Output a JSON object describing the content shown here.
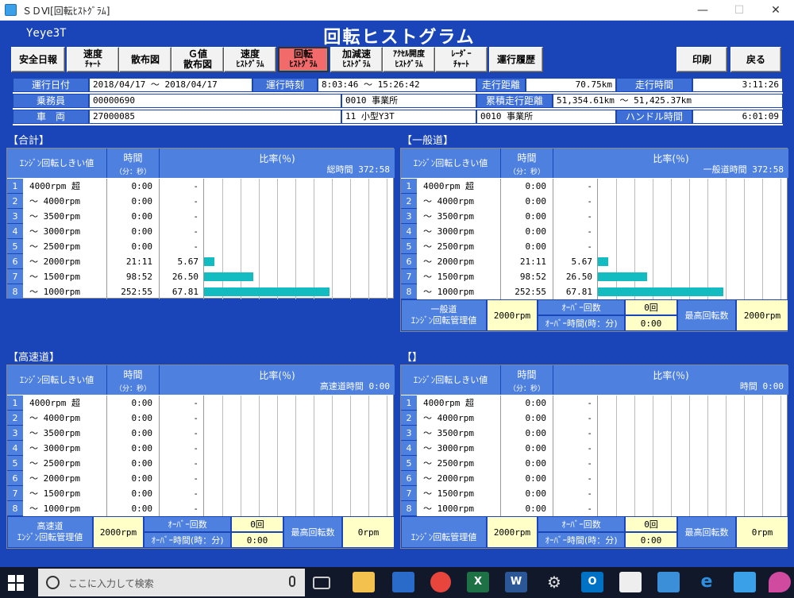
{
  "window": {
    "title": "ＳＤⅥ[回転ﾋｽﾄｸﾞﾗﾑ]",
    "minimize": "—",
    "maximize": "☐",
    "close": "✕"
  },
  "header": {
    "user": "Yeye3T",
    "title": "回転ヒストグラム"
  },
  "toolbar": {
    "safety_report": "安全日報",
    "speed_chart_1": "速度",
    "speed_chart_2": "ﾁｬｰﾄ",
    "scatter": "散布図",
    "g_scatter_1": "Ｇ値",
    "g_scatter_2": "散布図",
    "speed_hist_1": "速度",
    "speed_hist_2": "ﾋｽﾄｸﾞﾗﾑ",
    "rot_hist_1": "回転",
    "rot_hist_2": "ﾋｽﾄｸﾞﾗﾑ",
    "accel_hist_1": "加減速",
    "accel_hist_2": "ﾋｽﾄｸﾞﾗﾑ",
    "throttle_hist_1": "ｱｸｾﾙ開度",
    "throttle_hist_2": "ﾋｽﾄｸﾞﾗﾑ",
    "radar_1": "ﾚｰﾀﾞｰ",
    "radar_2": "ﾁｬｰﾄ",
    "history": "運行履歴",
    "print": "印刷",
    "back": "戻る"
  },
  "info": {
    "date_label": "運行日付",
    "date_value": "2018/04/17 ～ 2018/04/17",
    "time_label": "運行時刻",
    "time_value": "8:03:46 ～ 15:26:42",
    "distance_label": "走行距離",
    "distance_value": "70.75km",
    "runtime_label": "走行時間",
    "runtime_value": "3:11:26",
    "driver_label": "乗務員",
    "driver_value": "00000690",
    "office_value": "0010 事業所",
    "cum_label": "累積走行距離",
    "cum_value": "51,354.61km ～ 51,425.37km",
    "vehicle_label": "車　両",
    "vehicle_value": "27000085",
    "type_value": "11 小型Y3T",
    "office2_value": "0010 事業所",
    "handle_label": "ハンドル時間",
    "handle_value": "6:01:09"
  },
  "labels": {
    "threshold": "ｴﾝｼﾞﾝ回転しきい値",
    "time": "時間",
    "time_unit": "（分：秒）",
    "ratio": "比率(％)",
    "mgmt_1": "ｴﾝｼﾞﾝ回転管理値",
    "over_count": "ｵｰﾊﾞｰ回数",
    "over_time": "ｵｰﾊﾞｰ時間(時：分)",
    "max_rpm": "最高回転数"
  },
  "rows": [
    "4000rpm 超",
    "～ 4000rpm",
    "～ 3500rpm",
    "～ 3000rpm",
    "～ 2500rpm",
    "～ 2000rpm",
    "～ 1500rpm",
    "～ 1000rpm"
  ],
  "panels": {
    "total": {
      "title": "【合計】",
      "total_time": "総時間 372:58",
      "times": [
        "0:00",
        "0:00",
        "0:00",
        "0:00",
        "0:00",
        "21:11",
        "98:52",
        "252:55"
      ],
      "pcts": [
        "-",
        "-",
        "-",
        "-",
        "-",
        "5.67",
        "26.50",
        "67.81"
      ]
    },
    "general": {
      "title": "【一般道】",
      "total_time": "一般道時間 372:58",
      "times": [
        "0:00",
        "0:00",
        "0:00",
        "0:00",
        "0:00",
        "21:11",
        "98:52",
        "252:55"
      ],
      "pcts": [
        "-",
        "-",
        "-",
        "-",
        "-",
        "5.67",
        "26.50",
        "67.81"
      ],
      "footer": {
        "name": "一般道",
        "mgmt": "2000rpm",
        "over_count": "0回",
        "over_time": "0:00",
        "max": "2000rpm"
      }
    },
    "highway": {
      "title": "【高速道】",
      "total_time": "高速道時間 0:00",
      "times": [
        "0:00",
        "0:00",
        "0:00",
        "0:00",
        "0:00",
        "0:00",
        "0:00",
        "0:00"
      ],
      "pcts": [
        "-",
        "-",
        "-",
        "-",
        "-",
        "-",
        "-",
        "-"
      ],
      "footer": {
        "name": "高速道",
        "mgmt": "2000rpm",
        "over_count": "0回",
        "over_time": "0:00",
        "max": "0rpm"
      }
    },
    "other": {
      "title": "【】",
      "total_time": "時間 0:00",
      "times": [
        "0:00",
        "0:00",
        "0:00",
        "0:00",
        "0:00",
        "0:00",
        "0:00",
        "0:00"
      ],
      "pcts": [
        "-",
        "-",
        "-",
        "-",
        "-",
        "-",
        "-",
        "-"
      ],
      "footer": {
        "name": "",
        "mgmt": "2000rpm",
        "over_count": "0回",
        "over_time": "0:00",
        "max": "0rpm"
      }
    }
  },
  "chart_data": [
    {
      "type": "bar",
      "title": "【合計】",
      "categories": [
        "4000rpm 超",
        "～ 4000rpm",
        "～ 3500rpm",
        "～ 3000rpm",
        "～ 2500rpm",
        "～ 2000rpm",
        "～ 1500rpm",
        "～ 1000rpm"
      ],
      "values": [
        0,
        0,
        0,
        0,
        0,
        5.67,
        26.5,
        67.81
      ],
      "ylim": [
        0,
        100
      ]
    },
    {
      "type": "bar",
      "title": "【一般道】",
      "categories": [
        "4000rpm 超",
        "～ 4000rpm",
        "～ 3500rpm",
        "～ 3000rpm",
        "～ 2500rpm",
        "～ 2000rpm",
        "～ 1500rpm",
        "～ 1000rpm"
      ],
      "values": [
        0,
        0,
        0,
        0,
        0,
        5.67,
        26.5,
        67.81
      ],
      "ylim": [
        0,
        100
      ]
    },
    {
      "type": "bar",
      "title": "【高速道】",
      "categories": [
        "4000rpm 超",
        "～ 4000rpm",
        "～ 3500rpm",
        "～ 3000rpm",
        "～ 2500rpm",
        "～ 2000rpm",
        "～ 1500rpm",
        "～ 1000rpm"
      ],
      "values": [
        0,
        0,
        0,
        0,
        0,
        0,
        0,
        0
      ],
      "ylim": [
        0,
        100
      ]
    },
    {
      "type": "bar",
      "title": "【】",
      "categories": [
        "4000rpm 超",
        "～ 4000rpm",
        "～ 3500rpm",
        "～ 3000rpm",
        "～ 2500rpm",
        "～ 2000rpm",
        "～ 1500rpm",
        "～ 1000rpm"
      ],
      "values": [
        0,
        0,
        0,
        0,
        0,
        0,
        0,
        0
      ],
      "ylim": [
        0,
        100
      ]
    }
  ],
  "taskbar": {
    "search_placeholder": "ここに入力して検索"
  }
}
